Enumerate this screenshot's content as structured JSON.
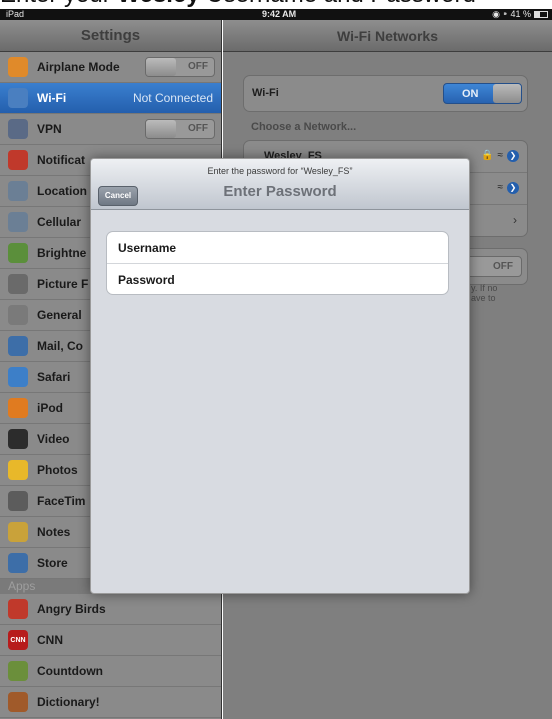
{
  "caption": {
    "pre": "Enter your ",
    "bold": "Wesley",
    "post": " Username and Password"
  },
  "status_bar": {
    "carrier": "iPad",
    "time": "9:42 AM",
    "battery": "41 %",
    "battery_level": 0.41
  },
  "settings": {
    "title": "Settings",
    "items": [
      {
        "label": "Airplane Mode",
        "toggle": "OFF",
        "icon": "airplane-icon",
        "color": "#e08a2a"
      },
      {
        "label": "Wi-Fi",
        "value": "Not Connected",
        "icon": "wifi-icon",
        "color": "#4a7fc0"
      },
      {
        "label": "VPN",
        "toggle": "OFF",
        "icon": "vpn-icon",
        "color": "#5a6a86"
      },
      {
        "label": "Notificat",
        "icon": "notifications-icon",
        "color": "#c0392b"
      },
      {
        "label": "Location",
        "icon": "location-icon",
        "color": "#6b7f95"
      },
      {
        "label": "Cellular",
        "icon": "cellular-icon",
        "color": "#6b7f95"
      },
      {
        "label": "Brightne",
        "icon": "brightness-icon",
        "color": "#5b8f3b"
      },
      {
        "label": "Picture F",
        "icon": "picture-frame-icon",
        "color": "#6a6a6a"
      },
      {
        "label": "General",
        "icon": "gear-icon",
        "color": "#7a7a7a"
      },
      {
        "label": "Mail, Co",
        "icon": "mail-icon",
        "color": "#3d6ea8"
      },
      {
        "label": "Safari",
        "icon": "safari-icon",
        "color": "#3d7fc8"
      },
      {
        "label": "iPod",
        "icon": "ipod-icon",
        "color": "#e07b20"
      },
      {
        "label": "Video",
        "icon": "video-icon",
        "color": "#2c2c2c"
      },
      {
        "label": "Photos",
        "icon": "photos-icon",
        "color": "#e8b82a"
      },
      {
        "label": "FaceTim",
        "icon": "facetime-icon",
        "color": "#5c5c5c"
      },
      {
        "label": "Notes",
        "icon": "notes-icon",
        "color": "#c9a23a"
      },
      {
        "label": "Store",
        "icon": "store-icon",
        "color": "#3d6ea8"
      }
    ],
    "apps_header": "Apps",
    "apps": [
      {
        "label": "Angry Birds",
        "icon": "angry-birds-icon",
        "color": "#c0392b"
      },
      {
        "label": "CNN",
        "icon": "cnn-icon",
        "color": "#b71c1c",
        "text": "CNN"
      },
      {
        "label": "Countdown",
        "icon": "countdown-icon",
        "color": "#6b8f3b"
      },
      {
        "label": "Dictionary!",
        "icon": "dictionary-icon",
        "color": "#a05a2a"
      }
    ]
  },
  "wifi": {
    "title": "Wi-Fi Networks",
    "wifi_label": "Wi-Fi",
    "wifi_toggle": "ON",
    "choose_label": "Choose a Network...",
    "network": "Wesley_FS",
    "ask_toggle": "OFF",
    "note": "y. If no\nave to"
  },
  "dialog": {
    "prompt": "Enter the password for “Wesley_FS”",
    "title": "Enter Password",
    "cancel": "Cancel",
    "username_label": "Username",
    "password_label": "Password",
    "username_value": "",
    "password_value": ""
  }
}
